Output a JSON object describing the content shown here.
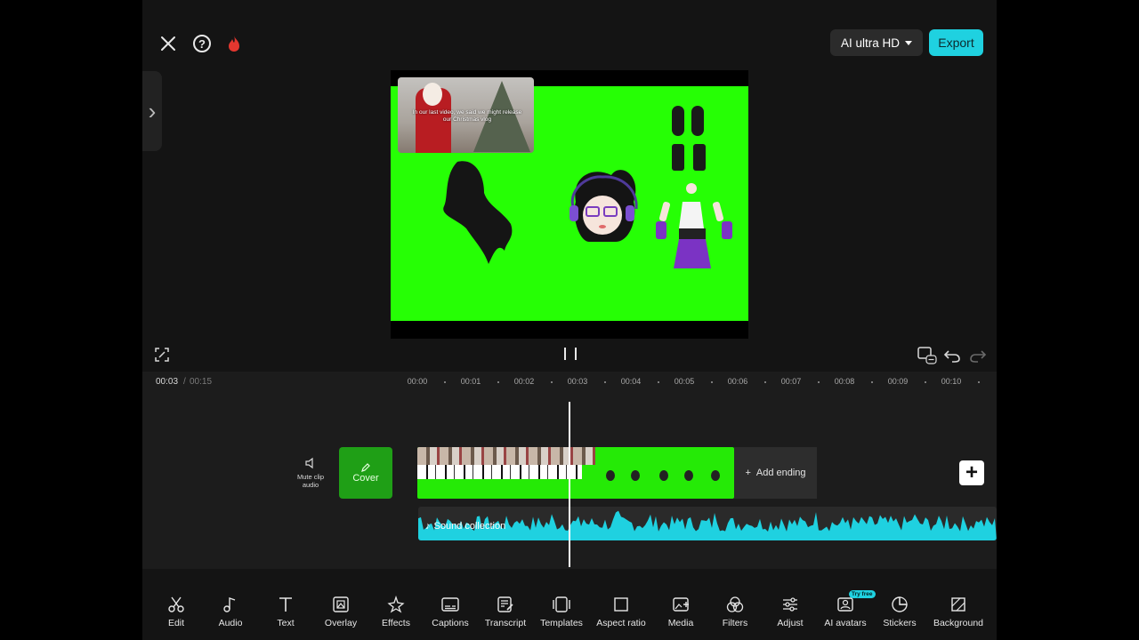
{
  "header": {
    "quality_label": "AI ultra HD",
    "export_label": "Export"
  },
  "preview": {
    "pip_caption": "In our last video, we said we might release our Christmas vlog"
  },
  "timeline": {
    "current_time": "00:03",
    "time_separator": "/",
    "total_time": "00:15",
    "ruler": [
      "00:00",
      "00:01",
      "00:02",
      "00:03",
      "00:04",
      "00:05",
      "00:06",
      "00:07",
      "00:08",
      "00:09",
      "00:10"
    ],
    "mute_label": "Mute clip audio",
    "cover_label": "Cover",
    "add_ending_label": "Add ending",
    "audio_label": "Sound collection"
  },
  "toolbar": {
    "items": [
      "Edit",
      "Audio",
      "Text",
      "Overlay",
      "Effects",
      "Captions",
      "Transcript",
      "Templates",
      "Aspect ratio",
      "Media",
      "Filters",
      "Adjust",
      "AI avatars",
      "Stickers",
      "Background"
    ],
    "badge": "Try free"
  },
  "colors": {
    "accent": "#1fd1e0",
    "green_screen": "#26ff05",
    "background": "#141414"
  }
}
